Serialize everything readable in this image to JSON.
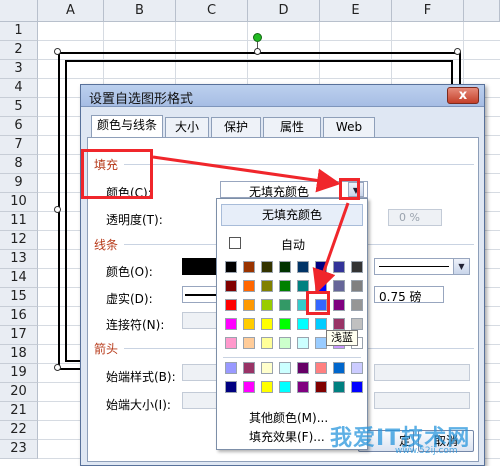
{
  "sheet": {
    "columns": [
      "A",
      "B",
      "C",
      "D",
      "E",
      "F"
    ],
    "rows": [
      "1",
      "2",
      "3",
      "4",
      "5",
      "6",
      "7",
      "8",
      "9",
      "10",
      "11",
      "12",
      "13",
      "14",
      "15",
      "16",
      "17",
      "18",
      "19",
      "20",
      "21",
      "22",
      "23"
    ]
  },
  "dialog": {
    "title": "设置自选图形格式",
    "close_label": "x",
    "tabs": [
      "颜色与线条",
      "大小",
      "保护",
      "属性",
      "Web"
    ],
    "fill": {
      "section": "填充",
      "color_label": "颜色(C):",
      "color_value": "无填充颜色",
      "transparency_label": "透明度(T):",
      "transparency_value": "0 %"
    },
    "line": {
      "section": "线条",
      "color_label": "颜色(O):",
      "dash_label": "虚实(D):",
      "connector_label": "连接符(N):",
      "weight_value": "0.75 磅"
    },
    "arrows": {
      "section": "箭头",
      "begin_style_label": "始端样式(B):",
      "begin_size_label": "始端大小(I):"
    },
    "ok_label": "定",
    "cancel_label": "取消"
  },
  "picker": {
    "no_fill": "无填充颜色",
    "auto_label": "自动",
    "more_colors": "其他颜色(M)...",
    "fill_effects": "填充效果(F)...",
    "tooltip": "浅蓝",
    "palette": [
      [
        "#000000",
        "#993300",
        "#333300",
        "#003300",
        "#003366",
        "#000080",
        "#333399",
        "#333333"
      ],
      [
        "#800000",
        "#FF6600",
        "#808000",
        "#008000",
        "#008080",
        "#0000FF",
        "#666699",
        "#808080"
      ],
      [
        "#FF0000",
        "#FF9900",
        "#99CC00",
        "#339966",
        "#33CCCC",
        "#3366FF",
        "#800080",
        "#969696"
      ],
      [
        "#FF00FF",
        "#FFCC00",
        "#FFFF00",
        "#00FF00",
        "#00FFFF",
        "#00CCFF",
        "#993366",
        "#C0C0C0"
      ],
      [
        "#FF99CC",
        "#FFCC99",
        "#FFFF99",
        "#CCFFCC",
        "#CCFFFF",
        "#99CCFF",
        "#CC99FF",
        "#FFFFFF"
      ]
    ],
    "palette2": [
      [
        "#9999FF",
        "#993366",
        "#FFFFCC",
        "#CCFFFF",
        "#660066",
        "#FF8080",
        "#0066CC",
        "#CCCCFF"
      ],
      [
        "#000080",
        "#FF00FF",
        "#FFFF00",
        "#00FFFF",
        "#800080",
        "#800000",
        "#008080",
        "#0000FF"
      ]
    ]
  },
  "watermark": {
    "text": "我爱IT技术网",
    "sub": "www.52ij.com"
  }
}
